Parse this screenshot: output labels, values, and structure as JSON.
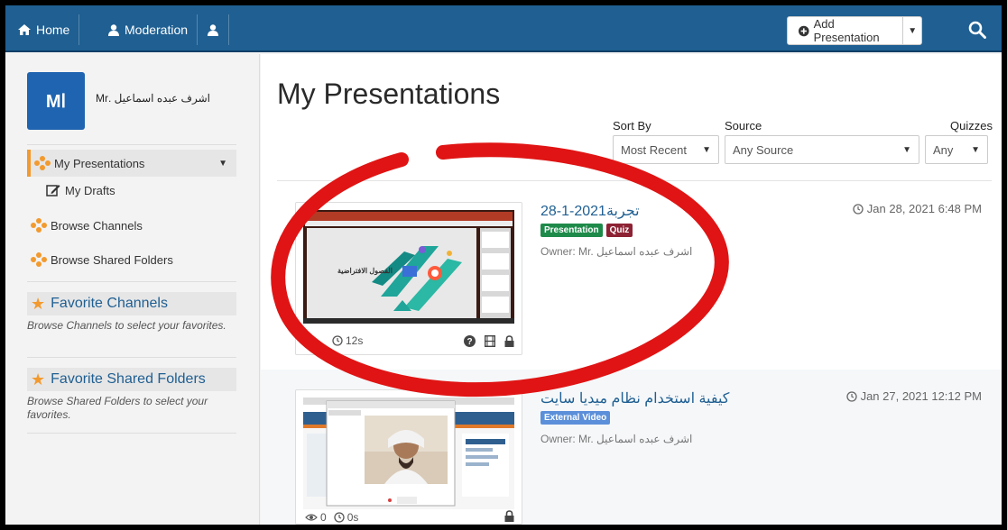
{
  "topbar": {
    "home_label": "Home",
    "moderation_label": "Moderation",
    "add_presentation_label": "Add Presentation"
  },
  "sidebar": {
    "avatar_initials": "Mا",
    "username": "اشرف عبده اسماعيل .Mr",
    "items": [
      {
        "label": "My Presentations",
        "icon": "presentation-dots-icon"
      },
      {
        "label": "My Drafts",
        "icon": "edit-icon"
      },
      {
        "label": "Browse Channels",
        "icon": "channels-dots-icon"
      },
      {
        "label": "Browse Shared Folders",
        "icon": "shared-dots-icon"
      }
    ],
    "favorite_channels": {
      "title": "Favorite Channels",
      "hint": "Browse Channels to select your favorites."
    },
    "favorite_folders": {
      "title": "Favorite Shared Folders",
      "hint": "Browse Shared Folders to select your favorites."
    }
  },
  "main": {
    "title": "My Presentations",
    "filters": {
      "sort_label": "Sort By",
      "sort_value": "Most Recent",
      "source_label": "Source",
      "source_value": "Any Source",
      "quizzes_label": "Quizzes",
      "quizzes_value": "Any"
    },
    "presentations": [
      {
        "title": "تجربة2021-1-28",
        "badges": [
          "Presentation",
          "Quiz"
        ],
        "owner": "Owner: Mr. اشرف عبده اسماعيل",
        "date": "Jan 28, 2021 6:48 PM",
        "duration": "12s",
        "thumb_text": "الفصول الافتراضية"
      },
      {
        "title": "كيفية استخدام نظام ميديا سايت",
        "badges": [
          "External Video"
        ],
        "owner": "Owner: Mr. اشرف عبده اسماعيل",
        "date": "Jan 27, 2021 12:12 PM",
        "views": "0",
        "duration": "0s"
      }
    ]
  },
  "colors": {
    "topbar": "#1f5f92",
    "accent_orange": "#f29a2e",
    "badge_presentation": "#1e8a4a",
    "badge_quiz": "#8c2233",
    "badge_external": "#5b8fd9",
    "annotation_red": "#e01414"
  }
}
